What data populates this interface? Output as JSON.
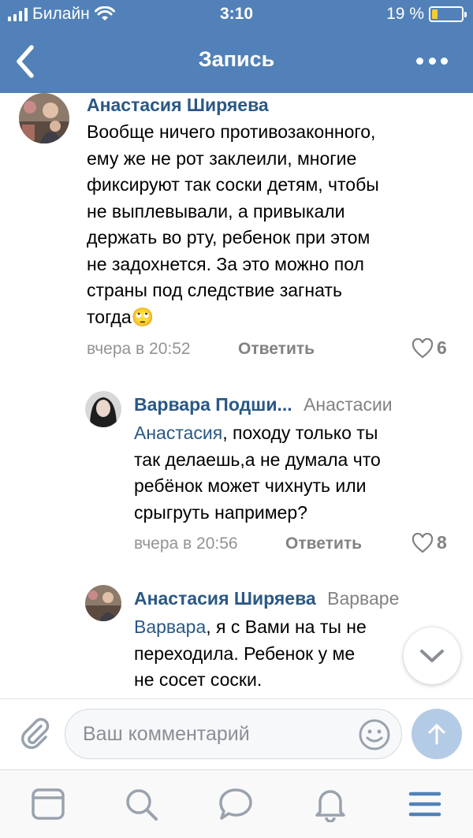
{
  "status_bar": {
    "carrier": "Билайн",
    "time": "3:10",
    "battery_percent": "19 %",
    "battery_level": 0.19
  },
  "header": {
    "title": "Запись",
    "back_icon": "chevron-left-icon",
    "more_icon": "more-dots-icon",
    "background_color": "#5181b8"
  },
  "comments": [
    {
      "author": "Анастасия Ширяева",
      "text_lines": [
        "Вообще ничего противозаконного,",
        "ему же не рот заклеили, многие",
        "фиксируют так соски детям, чтобы",
        "не выплевывали, а привыкали",
        "держать во рту, ребенок при этом",
        "не задохнется. За это можно пол",
        "страны под следствие загнать",
        "тогда"
      ],
      "emoji": "🙄",
      "time": "вчера в 20:52",
      "reply_label": "Ответить",
      "likes": "6"
    },
    {
      "author": "Варвара Подши...",
      "reply_to": "Анастасии",
      "mention": "Анастасия",
      "text_lines": [
        ", походу только ты",
        "так делаешь,а не думала что",
        "ребёнок может чихнуть или",
        "срыгруть например?"
      ],
      "time": "вчера в 20:56",
      "reply_label": "Ответить",
      "likes": "8"
    },
    {
      "author": "Анастасия Ширяева",
      "reply_to": "Варваре",
      "mention": "Варвара",
      "text_lines": [
        ", я с Вами на ты не",
        "переходила. Ребенок у ме",
        "не сосет соски."
      ]
    }
  ],
  "composer": {
    "placeholder": "Ваш комментарий",
    "attach_icon": "paperclip-icon",
    "emoji_icon": "smile-icon",
    "send_icon": "arrow-up-icon"
  },
  "tabbar": {
    "icons": [
      "news-icon",
      "search-icon",
      "messages-icon",
      "notifications-icon",
      "menu-icon"
    ]
  },
  "colors": {
    "accent": "#5181b8",
    "link": "#2a5885",
    "muted": "#828282"
  }
}
